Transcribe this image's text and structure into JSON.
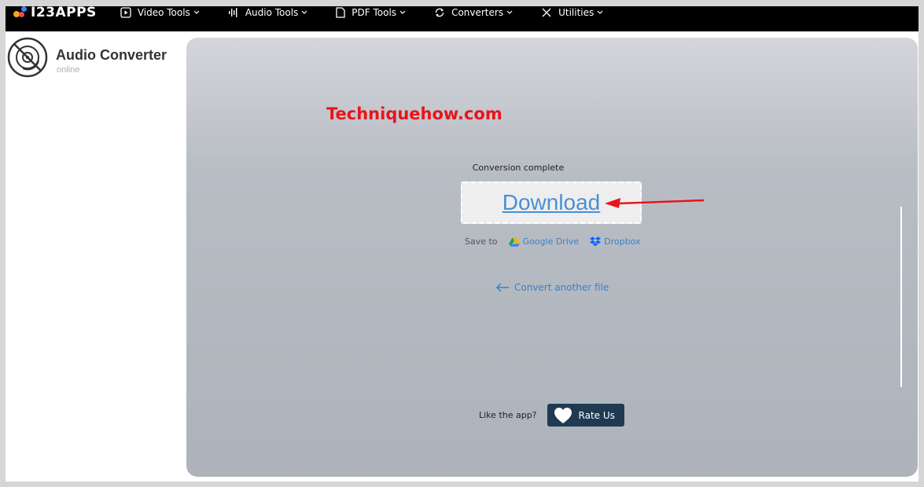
{
  "topbar": {
    "logo_text": "I23APPS",
    "nav": [
      {
        "label": "Video Tools",
        "icon": "play-icon"
      },
      {
        "label": "Audio Tools",
        "icon": "waveform-icon"
      },
      {
        "label": "PDF Tools",
        "icon": "document-icon"
      },
      {
        "label": "Converters",
        "icon": "convert-icon"
      },
      {
        "label": "Utilities",
        "icon": "tools-icon"
      }
    ]
  },
  "sidebar": {
    "app_title": "Audio Converter",
    "app_subtitle": "online"
  },
  "main": {
    "watermark": "Techniquehow.com",
    "status": "Conversion complete",
    "download_label": "Download",
    "save_to_label": "Save to",
    "google_drive_label": "Google Drive",
    "dropbox_label": "Dropbox",
    "convert_another_label": "Convert another file",
    "like_text": "Like the app?",
    "rate_label": "Rate Us"
  },
  "colors": {
    "accent_link": "#3a7fc8",
    "download_link": "#4a8fd4",
    "watermark": "#e8141b",
    "rate_button": "#1f3a52",
    "annotation_arrow": "#e8141b"
  }
}
